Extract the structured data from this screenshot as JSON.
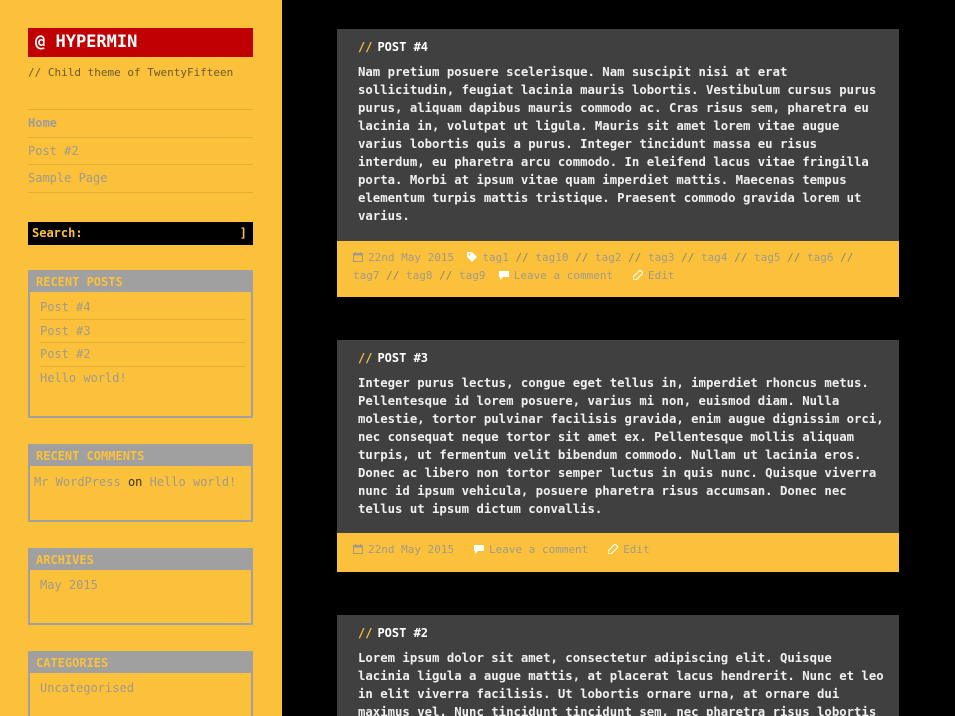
{
  "site": {
    "title": "@ HYPERMIN",
    "description": "// Child theme of TwentyFifteen"
  },
  "nav": {
    "items": [
      {
        "label": "Home"
      },
      {
        "label": "Post #2"
      },
      {
        "label": "Sample Page"
      }
    ]
  },
  "search": {
    "label": "Search: [",
    "close": "]",
    "value": ""
  },
  "widgets": {
    "recent_posts": {
      "title": "RECENT POSTS",
      "items": [
        {
          "label": "Post #4"
        },
        {
          "label": "Post #3"
        },
        {
          "label": "Post #2"
        },
        {
          "label": "Hello world!"
        }
      ]
    },
    "recent_comments": {
      "title": "RECENT COMMENTS",
      "author": "Mr WordPress",
      "on": "on",
      "post": "Hello world!"
    },
    "archives": {
      "title": "ARCHIVES",
      "items": [
        {
          "label": "May 2015"
        }
      ]
    },
    "categories": {
      "title": "CATEGORIES",
      "items": [
        {
          "label": "Uncategorised"
        }
      ]
    }
  },
  "posts": [
    {
      "prefix": "//",
      "title": "POST #4",
      "body": "Nam pretium posuere scelerisque. Nam suscipit nisi at erat sollicitudin, feugiat lacinia mauris lobortis. Vestibulum cursus purus purus, aliquam dapibus mauris commodo ac. Cras risus sem, pharetra eu lacinia in, volutpat ut ligula. Mauris sit amet lorem vitae augue varius lobortis quis a purus. Integer tincidunt massa eu risus interdum, eu pharetra arcu commodo. In eleifend lacus vitae fringilla porta. Morbi at ipsum vitae quam imperdiet mattis. Maecenas tempus elementum turpis mattis tristique. Praesent commodo gravida lorem ut varius.",
      "date": "22nd May 2015",
      "tags": [
        "tag1",
        "tag10",
        "tag2",
        "tag3",
        "tag4",
        "tag5",
        "tag6",
        "tag7",
        "tag8",
        "tag9"
      ],
      "tag_sep": "//",
      "comment": "Leave a comment",
      "edit": "Edit"
    },
    {
      "prefix": "//",
      "title": "POST #3",
      "body": "Integer purus lectus, congue eget tellus in, imperdiet rhoncus metus. Pellentesque id lorem posuere, varius mi non, euismod diam. Nulla molestie, tortor pulvinar facilisis gravida, enim augue dignissim orci, nec consequat neque tortor sit amet ex. Pellentesque mollis aliquam turpis, ut fermentum velit bibendum commodo. Nullam ut lacinia eros. Donec ac libero non tortor semper luctus in quis nunc. Quisque viverra nunc id ipsum vehicula, posuere pharetra risus accumsan. Donec nec tellus ut ipsum dictum convallis.",
      "date": "22nd May 2015",
      "comment": "Leave a comment",
      "edit": "Edit"
    },
    {
      "prefix": "//",
      "title": "POST #2",
      "body": "Lorem ipsum dolor sit amet, consectetur adipiscing elit. Quisque lacinia ligula a augue mattis, at placerat lacus hendrerit. Nunc et leo in elit viverra facilisis. Ut lobortis ornare urna, at ornare dui maximus vel. Nunc tincidunt tincidunt sem, nec pharetra risus lobortis"
    }
  ],
  "colors": {
    "sidebar_bg": "#fbc13b",
    "title_bg": "#c00000",
    "post_bg": "#404040",
    "page_bg": "#000000",
    "widget_border": "#a0a0a0"
  }
}
